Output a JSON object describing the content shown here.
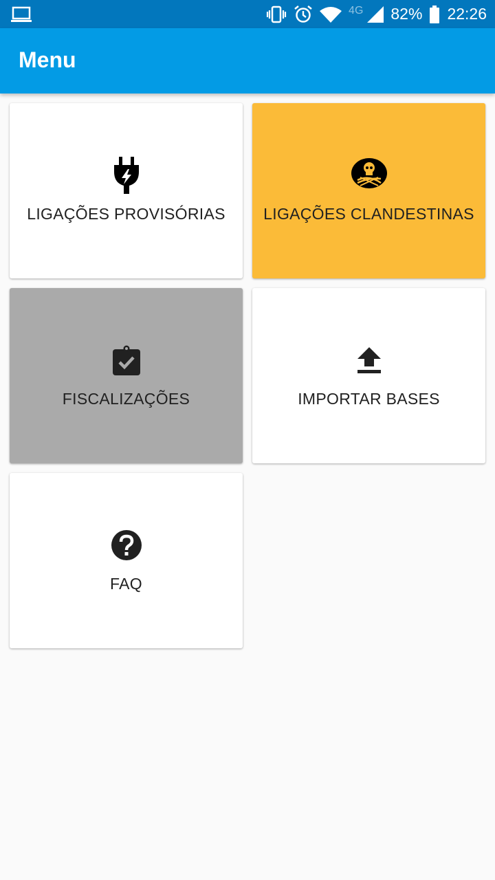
{
  "status_bar": {
    "network": "4G",
    "battery": "82%",
    "time": "22:26"
  },
  "app_bar": {
    "title": "Menu"
  },
  "menu": {
    "items": [
      {
        "label": "LIGAÇÕES PROVISÓRIAS",
        "icon": "power-plug-icon",
        "background": "#ffffff"
      },
      {
        "label": "LIGAÇÕES CLANDESTINAS",
        "icon": "pirate-skull-icon",
        "background": "#fbbb38"
      },
      {
        "label": "FISCALIZAÇÕES",
        "icon": "clipboard-check-icon",
        "background": "#aaaaaa"
      },
      {
        "label": "IMPORTAR BASES",
        "icon": "upload-icon",
        "background": "#ffffff"
      },
      {
        "label": "FAQ",
        "icon": "help-circle-icon",
        "background": "#ffffff"
      }
    ]
  },
  "colors": {
    "status_bar": "#0277bd",
    "app_bar": "#039be5",
    "background": "#fafafa"
  }
}
